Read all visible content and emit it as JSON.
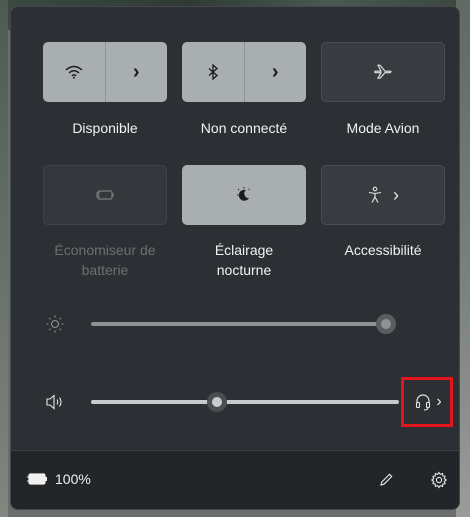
{
  "tiles": {
    "wifi": {
      "label": "Disponible",
      "icon": "wifi-icon",
      "arrow": "›"
    },
    "bluetooth": {
      "label": "Non connecté",
      "icon": "bluetooth-icon",
      "arrow": "›"
    },
    "airplane": {
      "label": "Mode Avion",
      "icon": "airplane-icon"
    },
    "battery_saver": {
      "label_line1": "Économiseur de",
      "label_line2": "batterie",
      "icon": "battery-saver-icon"
    },
    "night_light": {
      "label_line1": "Éclairage",
      "label_line2": "nocturne",
      "icon": "night-light-icon"
    },
    "accessibility": {
      "label": "Accessibilité",
      "icon": "accessibility-icon",
      "arrow": "›"
    }
  },
  "sliders": {
    "brightness": {
      "icon": "brightness-icon",
      "value": 100
    },
    "volume": {
      "icon": "speaker-icon",
      "value": 40,
      "output_icon": "headset-icon",
      "arrow": "›"
    }
  },
  "footer": {
    "battery_icon": "battery-charging-icon",
    "battery_percent": "100%",
    "edit_icon": "pencil-icon",
    "settings_icon": "gear-icon"
  },
  "colors": {
    "panel": "#2c2f33",
    "tile_on": "#a9afaf",
    "highlight": "#e3141b"
  }
}
